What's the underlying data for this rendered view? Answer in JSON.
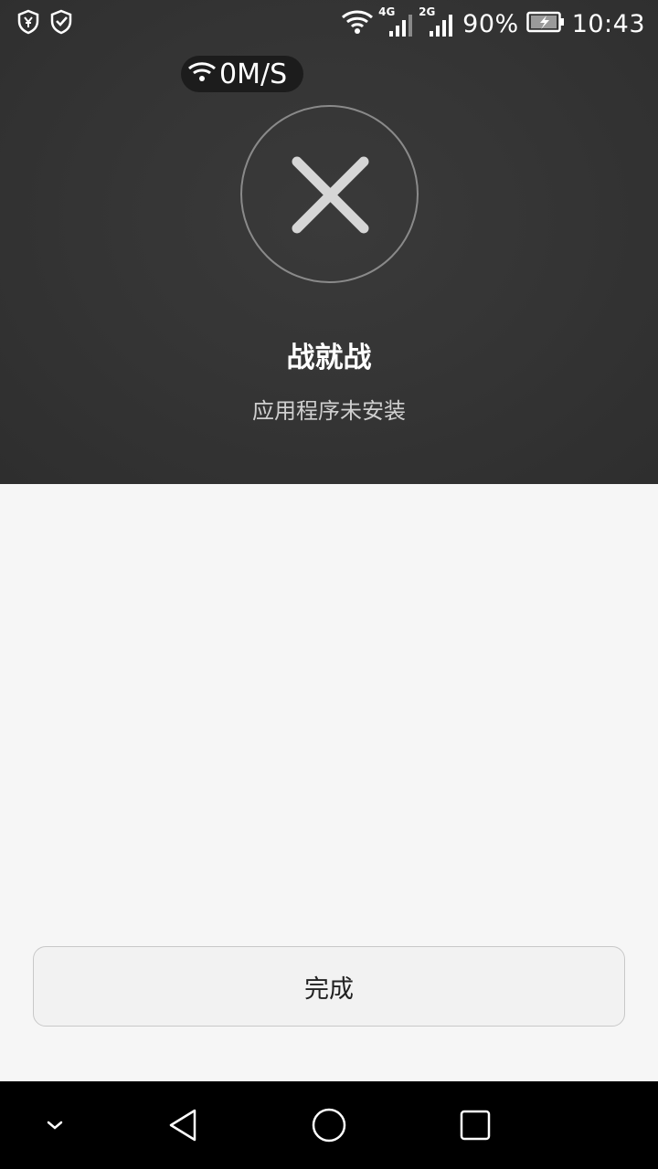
{
  "status_bar": {
    "left_icons": [
      "shield-yen-icon",
      "shield-check-icon"
    ],
    "wifi_icon": "wifi-icon",
    "signal_1": {
      "label": "4G",
      "icon": "cell-signal-icon"
    },
    "signal_2": {
      "label": "2G",
      "icon": "cell-signal-icon"
    },
    "battery_percent": "90%",
    "battery_icon": "battery-charging-icon",
    "time": "10:43"
  },
  "network_speed": {
    "icon": "wifi-icon",
    "value": "0M/S"
  },
  "result": {
    "icon": "close-icon",
    "app_name": "战就战",
    "message": "应用程序未安装"
  },
  "actions": {
    "done_label": "完成"
  },
  "nav_bar": {
    "items": [
      "collapse-chevron-icon",
      "back-triangle-icon",
      "home-circle-icon",
      "recents-square-icon"
    ]
  },
  "colors": {
    "panel_bg": "#333333",
    "content_bg": "#f6f6f6",
    "nav_bg": "#000000",
    "x_mark": "#d6d6d6"
  }
}
